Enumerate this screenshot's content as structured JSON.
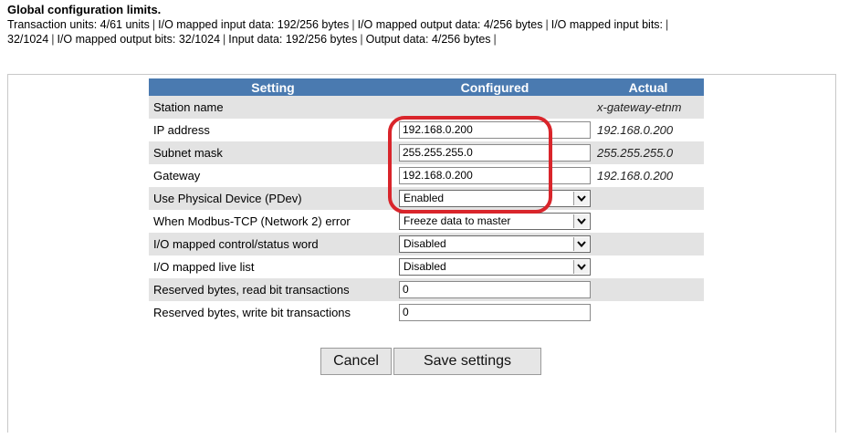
{
  "header": {
    "title": "Global configuration limits.",
    "limits": [
      "Transaction units: 4/61 units",
      "I/O mapped input data: 192/256 bytes",
      "I/O mapped output data: 4/256 bytes",
      "I/O mapped input bits:",
      "32/1024",
      "I/O mapped output bits: 32/1024",
      "Input data: 192/256 bytes",
      "Output data: 4/256 bytes"
    ]
  },
  "table": {
    "columns": [
      "Setting",
      "Configured",
      "Actual"
    ],
    "rows": [
      {
        "setting": "Station name",
        "configured": "",
        "actual": "x-gateway-etnm"
      },
      {
        "setting": "IP address",
        "configured": "192.168.0.200",
        "actual": "192.168.0.200"
      },
      {
        "setting": "Subnet mask",
        "configured": "255.255.255.0",
        "actual": "255.255.255.0"
      },
      {
        "setting": "Gateway",
        "configured": "192.168.0.200",
        "actual": "192.168.0.200"
      },
      {
        "setting": "Use Physical Device (PDev)",
        "configured": "Enabled",
        "actual": ""
      },
      {
        "setting": "When Modbus-TCP (Network 2) error",
        "configured": "Freeze data to master",
        "actual": ""
      },
      {
        "setting": "I/O mapped control/status word",
        "configured": "Disabled",
        "actual": ""
      },
      {
        "setting": "I/O mapped live list",
        "configured": "Disabled",
        "actual": ""
      },
      {
        "setting": "Reserved bytes, read bit transactions",
        "configured": "0",
        "actual": ""
      },
      {
        "setting": "Reserved bytes, write bit transactions",
        "configured": "0",
        "actual": ""
      }
    ]
  },
  "buttons": {
    "cancel": "Cancel",
    "save": "Save settings"
  },
  "icons": {
    "dropdown": "chevron-down-icon"
  },
  "colors": {
    "header_bg": "#4a7ab0",
    "highlight": "#d9252b",
    "row_alt": "#e3e3e3"
  }
}
